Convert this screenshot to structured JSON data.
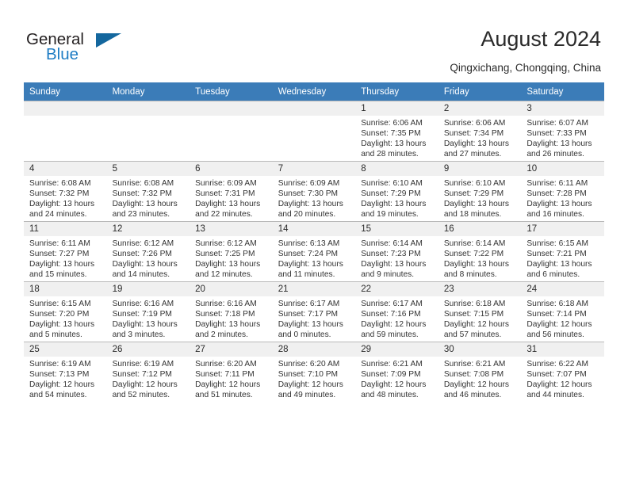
{
  "brand": {
    "name_part1": "General",
    "name_part2": "Blue",
    "triangle_color": "#14679E",
    "blue_color": "#1F7DC4"
  },
  "header": {
    "title": "August 2024",
    "location": "Qingxichang, Chongqing, China"
  },
  "calendar": {
    "header_bg": "#3B7CB8",
    "daynum_bg": "#F0F0F0",
    "weekday_headers": [
      "Sunday",
      "Monday",
      "Tuesday",
      "Wednesday",
      "Thursday",
      "Friday",
      "Saturday"
    ],
    "weeks": [
      [
        {
          "day": "",
          "sunrise": "",
          "sunset": "",
          "daylight1": "",
          "daylight2": ""
        },
        {
          "day": "",
          "sunrise": "",
          "sunset": "",
          "daylight1": "",
          "daylight2": ""
        },
        {
          "day": "",
          "sunrise": "",
          "sunset": "",
          "daylight1": "",
          "daylight2": ""
        },
        {
          "day": "",
          "sunrise": "",
          "sunset": "",
          "daylight1": "",
          "daylight2": ""
        },
        {
          "day": "1",
          "sunrise": "Sunrise: 6:06 AM",
          "sunset": "Sunset: 7:35 PM",
          "daylight1": "Daylight: 13 hours",
          "daylight2": "and 28 minutes."
        },
        {
          "day": "2",
          "sunrise": "Sunrise: 6:06 AM",
          "sunset": "Sunset: 7:34 PM",
          "daylight1": "Daylight: 13 hours",
          "daylight2": "and 27 minutes."
        },
        {
          "day": "3",
          "sunrise": "Sunrise: 6:07 AM",
          "sunset": "Sunset: 7:33 PM",
          "daylight1": "Daylight: 13 hours",
          "daylight2": "and 26 minutes."
        }
      ],
      [
        {
          "day": "4",
          "sunrise": "Sunrise: 6:08 AM",
          "sunset": "Sunset: 7:32 PM",
          "daylight1": "Daylight: 13 hours",
          "daylight2": "and 24 minutes."
        },
        {
          "day": "5",
          "sunrise": "Sunrise: 6:08 AM",
          "sunset": "Sunset: 7:32 PM",
          "daylight1": "Daylight: 13 hours",
          "daylight2": "and 23 minutes."
        },
        {
          "day": "6",
          "sunrise": "Sunrise: 6:09 AM",
          "sunset": "Sunset: 7:31 PM",
          "daylight1": "Daylight: 13 hours",
          "daylight2": "and 22 minutes."
        },
        {
          "day": "7",
          "sunrise": "Sunrise: 6:09 AM",
          "sunset": "Sunset: 7:30 PM",
          "daylight1": "Daylight: 13 hours",
          "daylight2": "and 20 minutes."
        },
        {
          "day": "8",
          "sunrise": "Sunrise: 6:10 AM",
          "sunset": "Sunset: 7:29 PM",
          "daylight1": "Daylight: 13 hours",
          "daylight2": "and 19 minutes."
        },
        {
          "day": "9",
          "sunrise": "Sunrise: 6:10 AM",
          "sunset": "Sunset: 7:29 PM",
          "daylight1": "Daylight: 13 hours",
          "daylight2": "and 18 minutes."
        },
        {
          "day": "10",
          "sunrise": "Sunrise: 6:11 AM",
          "sunset": "Sunset: 7:28 PM",
          "daylight1": "Daylight: 13 hours",
          "daylight2": "and 16 minutes."
        }
      ],
      [
        {
          "day": "11",
          "sunrise": "Sunrise: 6:11 AM",
          "sunset": "Sunset: 7:27 PM",
          "daylight1": "Daylight: 13 hours",
          "daylight2": "and 15 minutes."
        },
        {
          "day": "12",
          "sunrise": "Sunrise: 6:12 AM",
          "sunset": "Sunset: 7:26 PM",
          "daylight1": "Daylight: 13 hours",
          "daylight2": "and 14 minutes."
        },
        {
          "day": "13",
          "sunrise": "Sunrise: 6:12 AM",
          "sunset": "Sunset: 7:25 PM",
          "daylight1": "Daylight: 13 hours",
          "daylight2": "and 12 minutes."
        },
        {
          "day": "14",
          "sunrise": "Sunrise: 6:13 AM",
          "sunset": "Sunset: 7:24 PM",
          "daylight1": "Daylight: 13 hours",
          "daylight2": "and 11 minutes."
        },
        {
          "day": "15",
          "sunrise": "Sunrise: 6:14 AM",
          "sunset": "Sunset: 7:23 PM",
          "daylight1": "Daylight: 13 hours",
          "daylight2": "and 9 minutes."
        },
        {
          "day": "16",
          "sunrise": "Sunrise: 6:14 AM",
          "sunset": "Sunset: 7:22 PM",
          "daylight1": "Daylight: 13 hours",
          "daylight2": "and 8 minutes."
        },
        {
          "day": "17",
          "sunrise": "Sunrise: 6:15 AM",
          "sunset": "Sunset: 7:21 PM",
          "daylight1": "Daylight: 13 hours",
          "daylight2": "and 6 minutes."
        }
      ],
      [
        {
          "day": "18",
          "sunrise": "Sunrise: 6:15 AM",
          "sunset": "Sunset: 7:20 PM",
          "daylight1": "Daylight: 13 hours",
          "daylight2": "and 5 minutes."
        },
        {
          "day": "19",
          "sunrise": "Sunrise: 6:16 AM",
          "sunset": "Sunset: 7:19 PM",
          "daylight1": "Daylight: 13 hours",
          "daylight2": "and 3 minutes."
        },
        {
          "day": "20",
          "sunrise": "Sunrise: 6:16 AM",
          "sunset": "Sunset: 7:18 PM",
          "daylight1": "Daylight: 13 hours",
          "daylight2": "and 2 minutes."
        },
        {
          "day": "21",
          "sunrise": "Sunrise: 6:17 AM",
          "sunset": "Sunset: 7:17 PM",
          "daylight1": "Daylight: 13 hours",
          "daylight2": "and 0 minutes."
        },
        {
          "day": "22",
          "sunrise": "Sunrise: 6:17 AM",
          "sunset": "Sunset: 7:16 PM",
          "daylight1": "Daylight: 12 hours",
          "daylight2": "and 59 minutes."
        },
        {
          "day": "23",
          "sunrise": "Sunrise: 6:18 AM",
          "sunset": "Sunset: 7:15 PM",
          "daylight1": "Daylight: 12 hours",
          "daylight2": "and 57 minutes."
        },
        {
          "day": "24",
          "sunrise": "Sunrise: 6:18 AM",
          "sunset": "Sunset: 7:14 PM",
          "daylight1": "Daylight: 12 hours",
          "daylight2": "and 56 minutes."
        }
      ],
      [
        {
          "day": "25",
          "sunrise": "Sunrise: 6:19 AM",
          "sunset": "Sunset: 7:13 PM",
          "daylight1": "Daylight: 12 hours",
          "daylight2": "and 54 minutes."
        },
        {
          "day": "26",
          "sunrise": "Sunrise: 6:19 AM",
          "sunset": "Sunset: 7:12 PM",
          "daylight1": "Daylight: 12 hours",
          "daylight2": "and 52 minutes."
        },
        {
          "day": "27",
          "sunrise": "Sunrise: 6:20 AM",
          "sunset": "Sunset: 7:11 PM",
          "daylight1": "Daylight: 12 hours",
          "daylight2": "and 51 minutes."
        },
        {
          "day": "28",
          "sunrise": "Sunrise: 6:20 AM",
          "sunset": "Sunset: 7:10 PM",
          "daylight1": "Daylight: 12 hours",
          "daylight2": "and 49 minutes."
        },
        {
          "day": "29",
          "sunrise": "Sunrise: 6:21 AM",
          "sunset": "Sunset: 7:09 PM",
          "daylight1": "Daylight: 12 hours",
          "daylight2": "and 48 minutes."
        },
        {
          "day": "30",
          "sunrise": "Sunrise: 6:21 AM",
          "sunset": "Sunset: 7:08 PM",
          "daylight1": "Daylight: 12 hours",
          "daylight2": "and 46 minutes."
        },
        {
          "day": "31",
          "sunrise": "Sunrise: 6:22 AM",
          "sunset": "Sunset: 7:07 PM",
          "daylight1": "Daylight: 12 hours",
          "daylight2": "and 44 minutes."
        }
      ]
    ]
  }
}
